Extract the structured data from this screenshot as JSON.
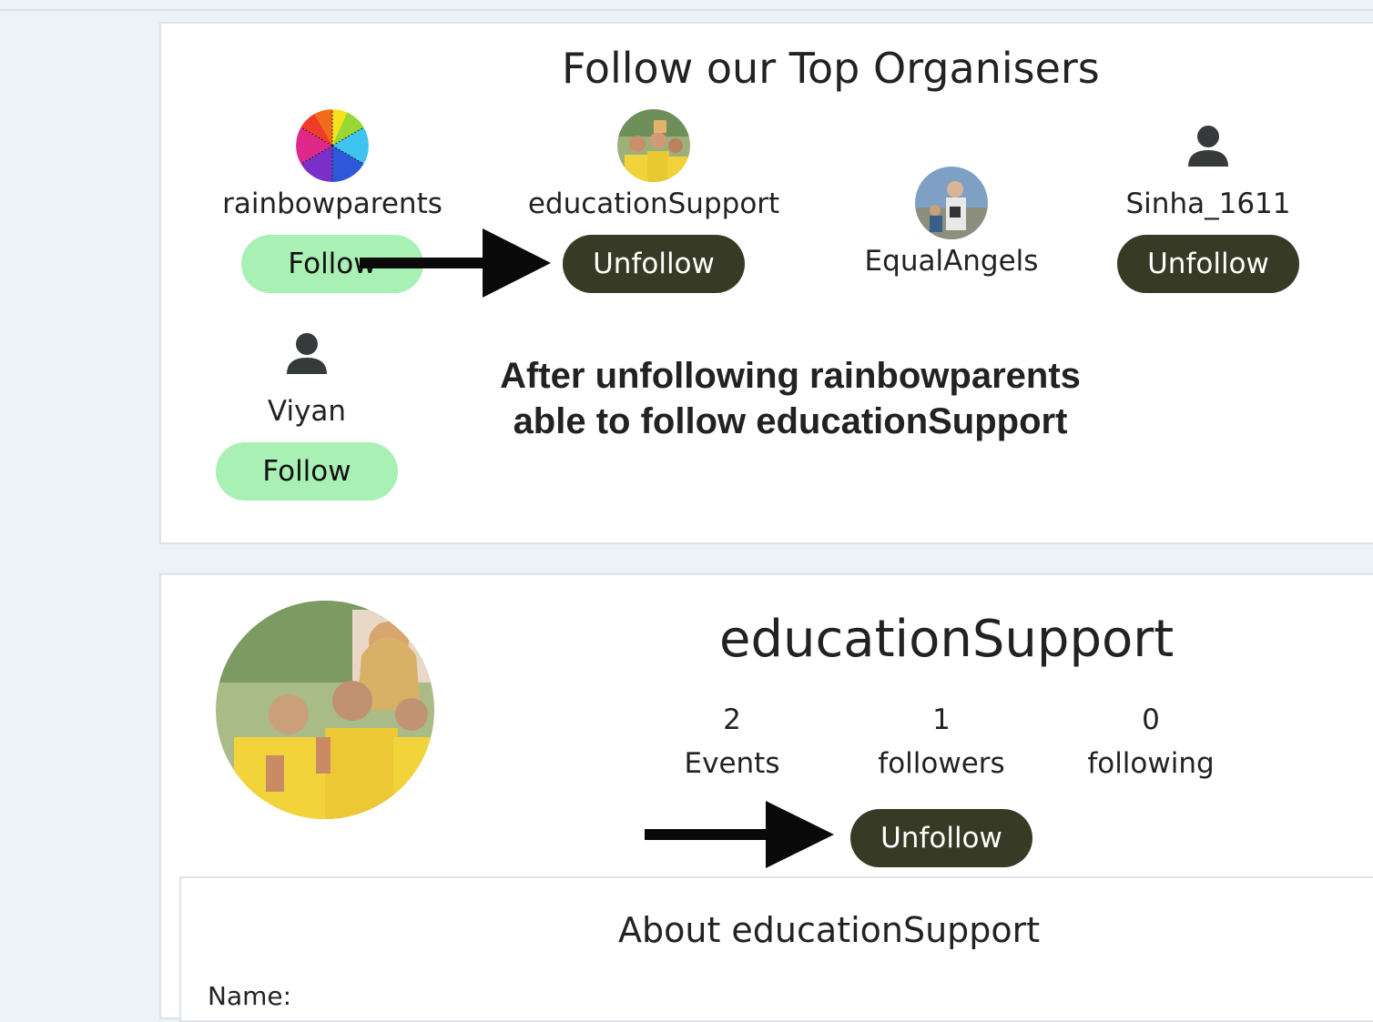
{
  "organisers": {
    "title": "Follow our Top Organisers",
    "items": [
      {
        "name": "rainbowparents",
        "button": "Follow"
      },
      {
        "name": "educationSupport",
        "button": "Unfollow"
      },
      {
        "name": "EqualAngels"
      },
      {
        "name": "Sinha_1611",
        "button": "Unfollow"
      },
      {
        "name": "Viyan",
        "button": "Follow"
      }
    ],
    "annotation_line1": "After unfollowing rainbowparents",
    "annotation_line2": "able to follow educationSupport"
  },
  "profile": {
    "name": "educationSupport",
    "stats": [
      {
        "value": "2",
        "label": "Events"
      },
      {
        "value": "1",
        "label": "followers"
      },
      {
        "value": "0",
        "label": "following"
      }
    ],
    "button": "Unfollow"
  },
  "about": {
    "title": "About educationSupport",
    "name_label": "Name:"
  },
  "colors": {
    "follow_bg": "#a8f0b4",
    "unfollow_bg": "#373a24",
    "page_bg": "#edf2f7"
  },
  "icons": [
    "user-icon",
    "arrow-right-icon"
  ]
}
